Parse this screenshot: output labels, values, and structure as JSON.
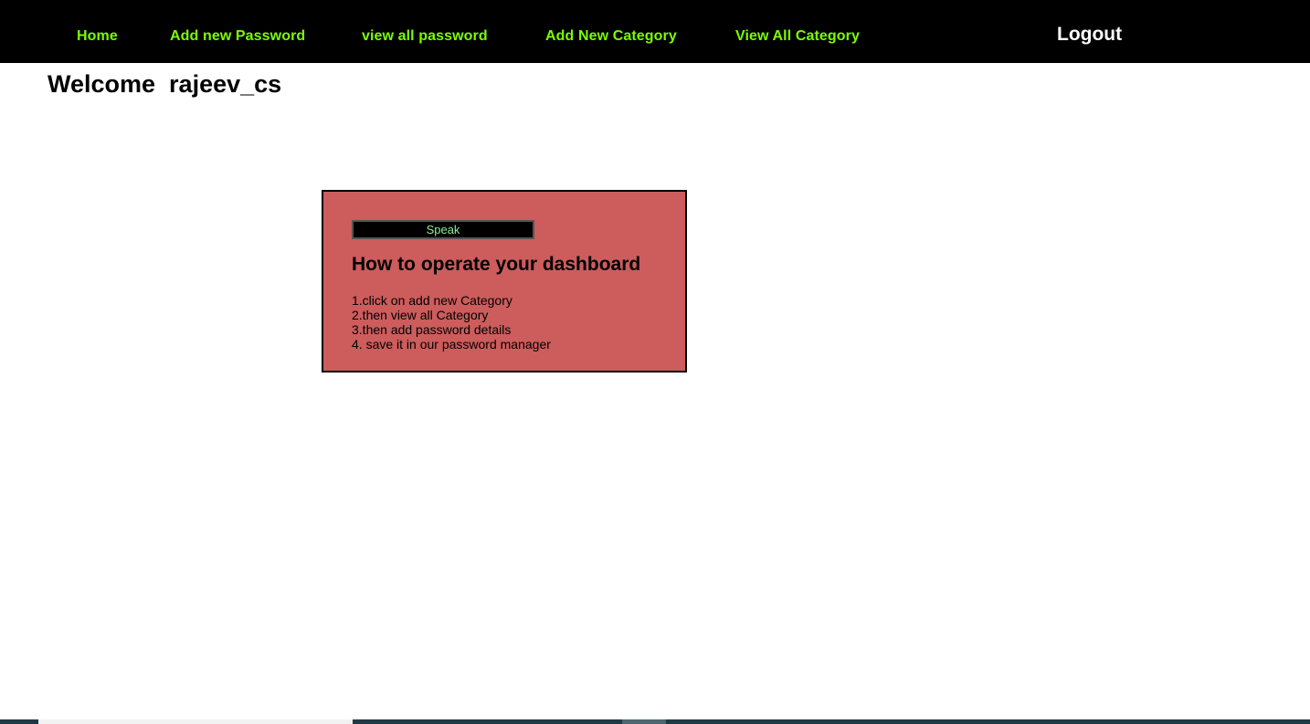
{
  "nav": {
    "items": [
      {
        "label": "Home"
      },
      {
        "label": "Add new Password"
      },
      {
        "label": "view all password"
      },
      {
        "label": "Add New Category"
      },
      {
        "label": "View All Category"
      }
    ],
    "logout_label": "Logout"
  },
  "welcome": {
    "text": "Welcome  rajeev_cs"
  },
  "card": {
    "speak_label": "Speak",
    "title": "How to operate your dashboard",
    "steps": [
      "1.click on add new Category",
      "2.then view all Category",
      "3.then add password details",
      "4. save it in our password manager"
    ]
  },
  "colors": {
    "nav_background": "#000000",
    "nav_link": "#7cfc00",
    "logout": "#ffffff",
    "card_background": "#cd5c5c",
    "speak_text": "#90ee90"
  }
}
